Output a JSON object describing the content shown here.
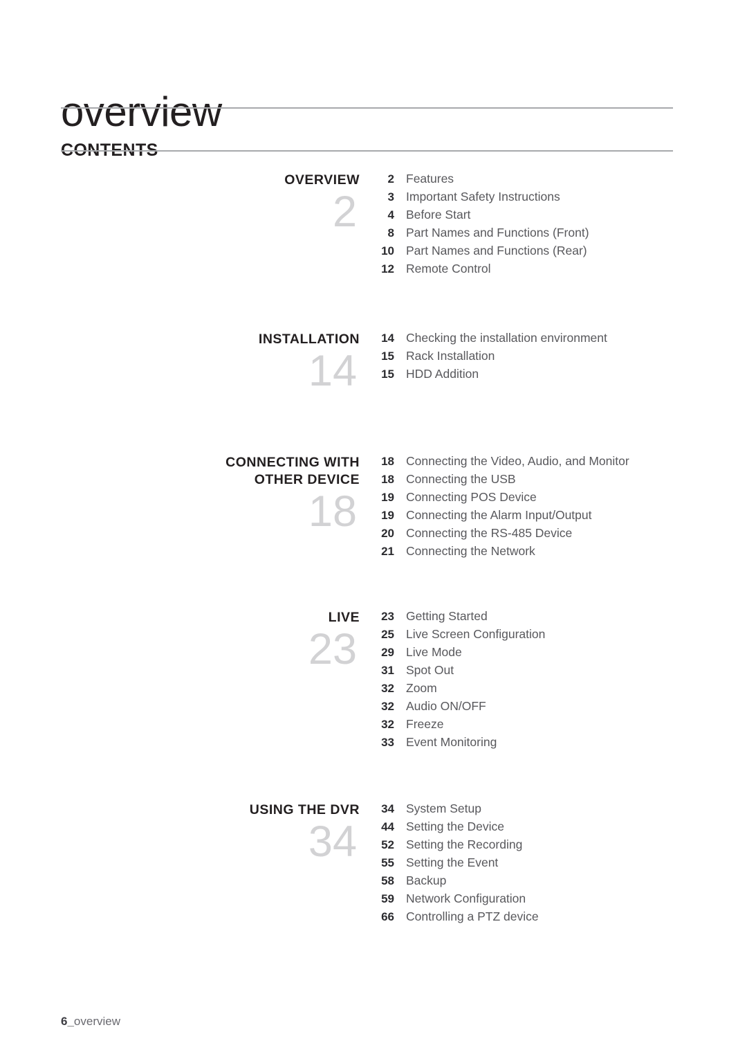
{
  "header": {
    "title": "overview",
    "contents_heading": "CONTENTS"
  },
  "footer": {
    "page_number": "6_",
    "label": "overview"
  },
  "colors": {
    "title": "#231f20",
    "rule": "#a7a9ac",
    "big_number": "#d2d2d4",
    "entry_page": "#2b2b2f",
    "entry_name": "#58585c"
  },
  "toc": {
    "sections": [
      {
        "title": "OVERVIEW",
        "big_number": "2",
        "entries": [
          {
            "page": "2",
            "name": "Features"
          },
          {
            "page": "3",
            "name": "Important Safety Instructions"
          },
          {
            "page": "4",
            "name": "Before Start"
          },
          {
            "page": "8",
            "name": "Part Names and Functions (Front)"
          },
          {
            "page": "10",
            "name": "Part Names and Functions (Rear)"
          },
          {
            "page": "12",
            "name": "Remote Control"
          }
        ]
      },
      {
        "title": "INSTALLATION",
        "big_number": "14",
        "entries": [
          {
            "page": "14",
            "name": "Checking the installation environment"
          },
          {
            "page": "15",
            "name": "Rack Installation"
          },
          {
            "page": "15",
            "name": "HDD Addition"
          }
        ]
      },
      {
        "title": "CONNECTING WITH\nOTHER DEVICE",
        "big_number": "18",
        "entries": [
          {
            "page": "18",
            "name": "Connecting the Video, Audio, and Monitor"
          },
          {
            "page": "18",
            "name": "Connecting the USB"
          },
          {
            "page": "19",
            "name": "Connecting POS Device"
          },
          {
            "page": "19",
            "name": "Connecting the Alarm Input/Output"
          },
          {
            "page": "20",
            "name": "Connecting the RS-485 Device"
          },
          {
            "page": "21",
            "name": "Connecting the Network"
          }
        ]
      },
      {
        "title": "LIVE",
        "big_number": "23",
        "entries": [
          {
            "page": "23",
            "name": "Getting Started"
          },
          {
            "page": "25",
            "name": "Live Screen Configuration"
          },
          {
            "page": "29",
            "name": "Live Mode"
          },
          {
            "page": "31",
            "name": "Spot Out"
          },
          {
            "page": "32",
            "name": "Zoom"
          },
          {
            "page": "32",
            "name": "Audio ON/OFF"
          },
          {
            "page": "32",
            "name": "Freeze"
          },
          {
            "page": "33",
            "name": "Event Monitoring"
          }
        ]
      },
      {
        "title": "USING THE DVR",
        "big_number": "34",
        "entries": [
          {
            "page": "34",
            "name": "System Setup"
          },
          {
            "page": "44",
            "name": "Setting the Device"
          },
          {
            "page": "52",
            "name": "Setting the Recording"
          },
          {
            "page": "55",
            "name": "Setting the Event"
          },
          {
            "page": "58",
            "name": "Backup"
          },
          {
            "page": "59",
            "name": "Network Configuration"
          },
          {
            "page": "66",
            "name": "Controlling a PTZ device"
          }
        ]
      }
    ]
  }
}
